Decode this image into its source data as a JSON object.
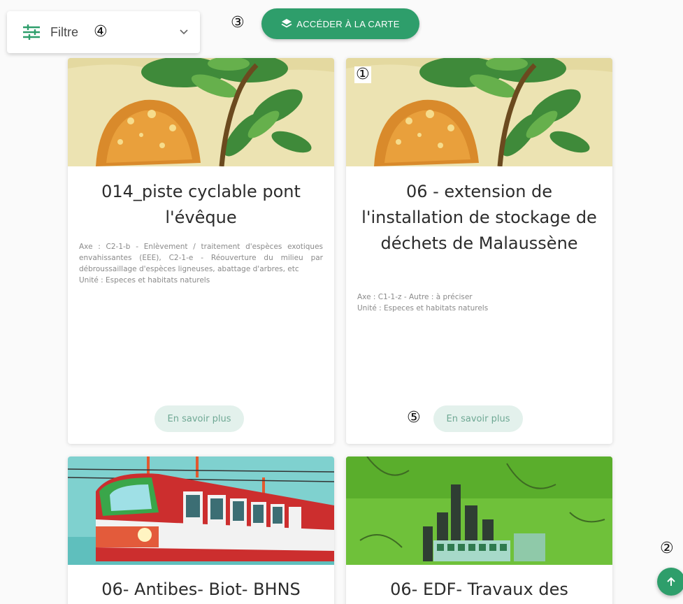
{
  "filter": {
    "label": "Filtre",
    "marker": "④",
    "icon": "sliders-icon",
    "chevron": "chevron-down-icon"
  },
  "map_button": {
    "label": "ACCÉDER À LA CARTE",
    "marker": "③",
    "icon": "layers-icon"
  },
  "cards": [
    {
      "title": "014_piste cyclable pont l'évêque",
      "axe": "Axe : C2-1-b - Enlèvement / traitement d'espèces exotiques envahissantes (EEE), C2-1-e - Réouverture du milieu par débroussaillage d'espèces ligneuses, abattage d'arbres, etc",
      "unite": "Unité : Especes et habitats naturels",
      "button": "En savoir plus",
      "image": "mushroom-illustration"
    },
    {
      "title": "06 - extension de l'installation de stockage de déchets de Malaussène",
      "axe": "Axe : C1-1-z - Autre : à préciser",
      "unite": "Unité : Especes et habitats naturels",
      "button": "En savoir plus",
      "image_marker": "①",
      "button_marker": "⑤",
      "image": "mushroom-illustration"
    },
    {
      "title": "06- Antibes- Biot- BHNS",
      "image": "tram-illustration"
    },
    {
      "title": "06- EDF- Travaux des",
      "image": "city-illustration"
    }
  ],
  "scroll_top": {
    "marker": "②",
    "icon": "arrow-up-icon"
  },
  "colors": {
    "accent": "#2e9e6b",
    "button_bg": "#e3f1ec",
    "button_text": "#6fa894"
  }
}
